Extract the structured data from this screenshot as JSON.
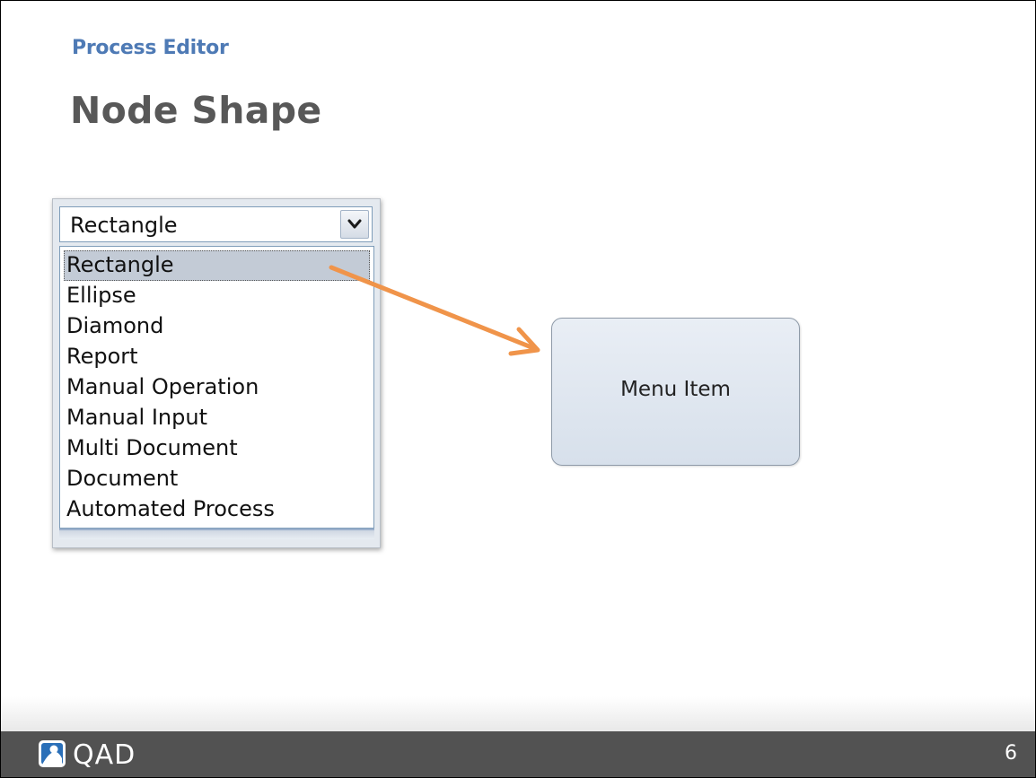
{
  "header": {
    "subtitle": "Process Editor",
    "title": "Node Shape"
  },
  "dropdown": {
    "selected_value": "Rectangle",
    "highlighted_index": 0,
    "options": [
      "Rectangle",
      "Ellipse",
      "Diamond",
      "Report",
      "Manual Operation",
      "Manual Input",
      "Multi Document",
      "Document",
      "Automated Process"
    ]
  },
  "node": {
    "label": "Menu Item"
  },
  "footer": {
    "brand": "QAD",
    "page_number": "6"
  },
  "colors": {
    "subtitle": "#4e7ab5",
    "title": "#585858",
    "arrow": "#f0944a",
    "footer_bar": "#525252"
  }
}
